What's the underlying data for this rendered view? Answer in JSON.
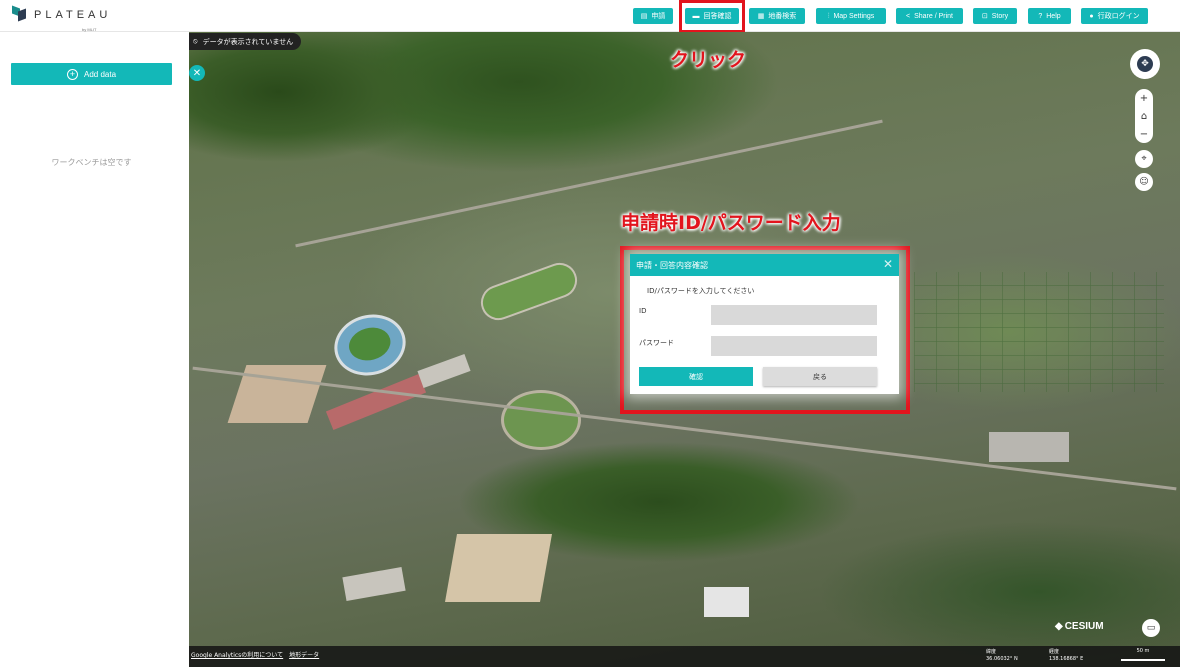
{
  "header": {
    "logo_text": "PLATEAU",
    "logo_sub": "by MLIT",
    "nav": [
      {
        "label": "申請",
        "icon": "document-icon"
      },
      {
        "label": "回答確認",
        "icon": "id-card-icon"
      },
      {
        "label": "地番検索",
        "icon": "building-icon"
      },
      {
        "label": "Map Settings",
        "icon": "sliders-icon"
      },
      {
        "label": "Share / Print",
        "icon": "share-icon"
      },
      {
        "label": "Story",
        "icon": "story-icon"
      },
      {
        "label": "Help",
        "icon": "help-icon"
      },
      {
        "label": "行政ログイン",
        "icon": "user-icon"
      }
    ]
  },
  "sidebar": {
    "add_data_label": "Add data",
    "empty_message": "ワークベンチは空です"
  },
  "map": {
    "no_data_notice": "データが表示されていません",
    "annotation_click": "クリック",
    "annotation_login": "申請時ID/パスワード入力"
  },
  "dialog": {
    "title": "申請・回答内容確認",
    "prompt": "ID/パスワードを入力してください",
    "id_label": "ID",
    "password_label": "パスワード",
    "id_value": "",
    "password_value": "",
    "confirm_label": "確認",
    "back_label": "戻る"
  },
  "footer": {
    "links": [
      "Google Analyticsの利用について",
      "地形データ"
    ],
    "lat_label": "緯度",
    "lat_value": "36.06032° N",
    "lon_label": "経度",
    "lon_value": "138.16868° E",
    "scale_label": "50 m",
    "attribution": "CESIUM"
  },
  "colors": {
    "accent": "#13b8b8",
    "annotation_red": "#e2141d"
  }
}
